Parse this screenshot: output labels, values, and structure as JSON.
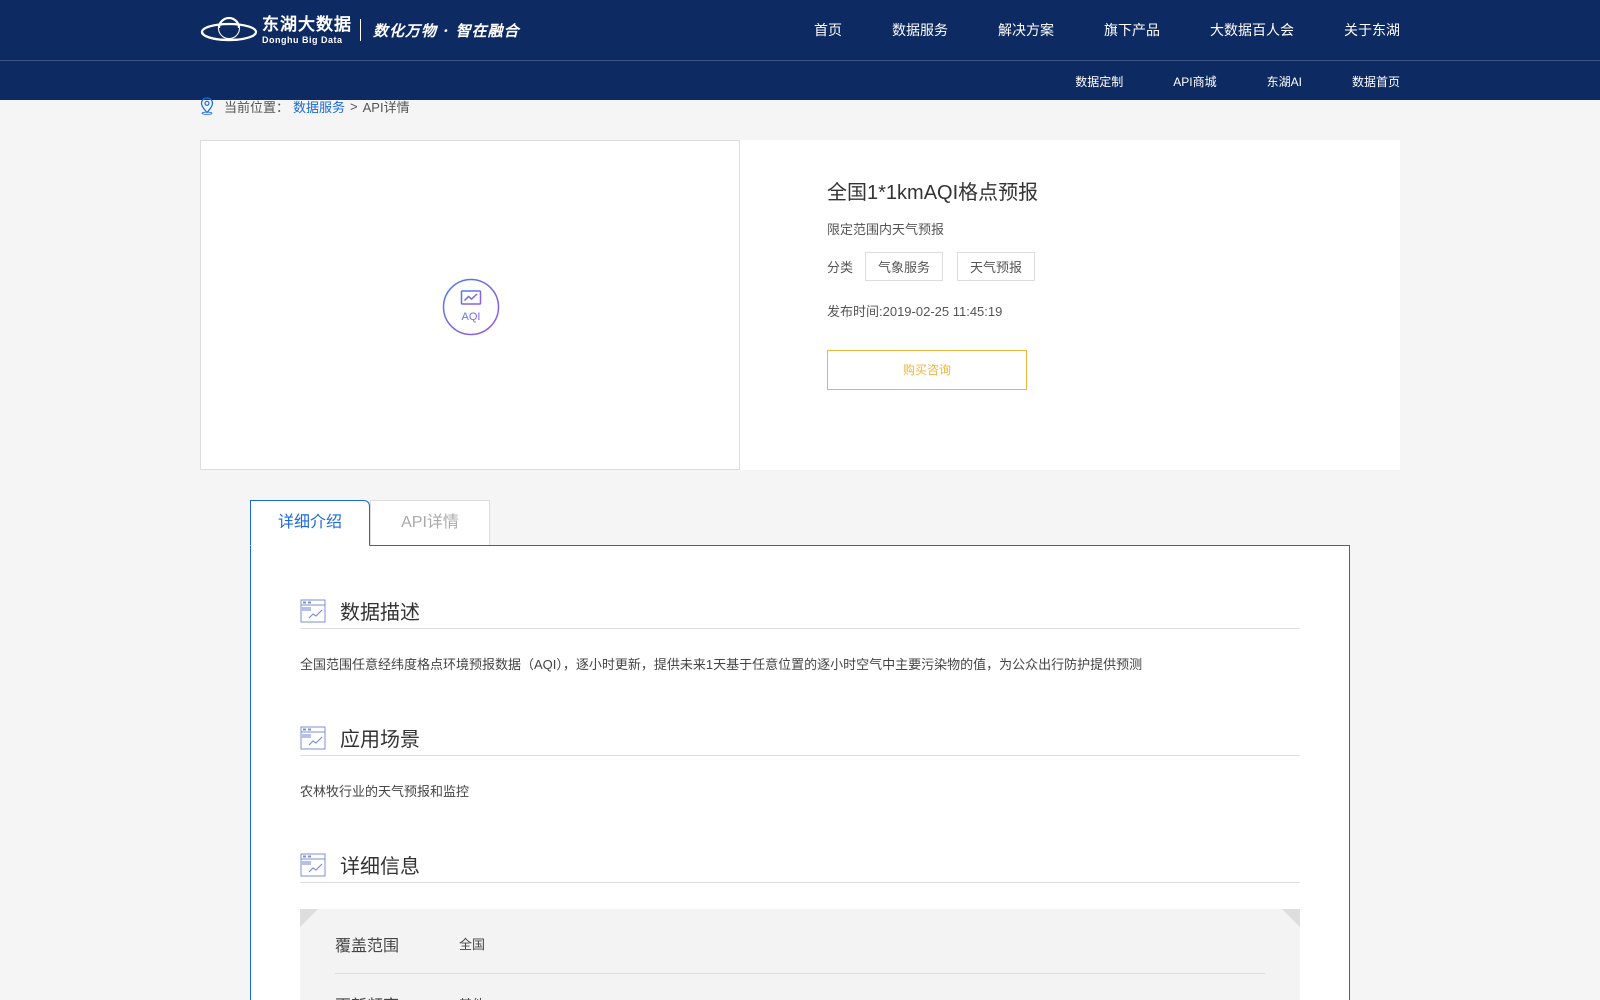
{
  "header": {
    "logo_cn": "东湖大数据",
    "logo_en": "Donghu Big Data",
    "slogan": "数化万物 · 智在融合",
    "nav": [
      "首页",
      "数据服务",
      "解决方案",
      "旗下产品",
      "大数据百人会",
      "关于东湖"
    ],
    "subnav": [
      "数据定制",
      "API商城",
      "东湖AI",
      "数据首页"
    ]
  },
  "breadcrumb": {
    "prefix": "当前位置：",
    "link": "数据服务",
    "separator": ">",
    "current": "API详情"
  },
  "product": {
    "icon_label": "AQI",
    "title": "全国1*1kmAQI格点预报",
    "subtitle": "限定范围内天气预报",
    "category_label": "分类",
    "tags": [
      "气象服务",
      "天气预报"
    ],
    "publish": "发布时间:2019-02-25 11:45:19",
    "buy_button": "购买咨询"
  },
  "tabs": {
    "active": "详细介绍",
    "inactive": "API详情"
  },
  "sections": {
    "desc_title": "数据描述",
    "desc_text": "全国范围任意经纬度格点环境预报数据（AQI），逐小时更新，提供未来1天基于任意位置的逐小时空气中主要污染物的值，为公众出行防护提供预测",
    "scene_title": "应用场景",
    "scene_text": "农林牧行业的天气预报和监控",
    "detail_title": "详细信息"
  },
  "details": [
    {
      "key": "覆盖范围",
      "value": "全国"
    },
    {
      "key": "更新频率",
      "value": "其他"
    }
  ],
  "colors": {
    "header_bg": "#0e2a63",
    "accent_blue": "#1a6ad9",
    "buy_orange": "#f0b53c"
  }
}
